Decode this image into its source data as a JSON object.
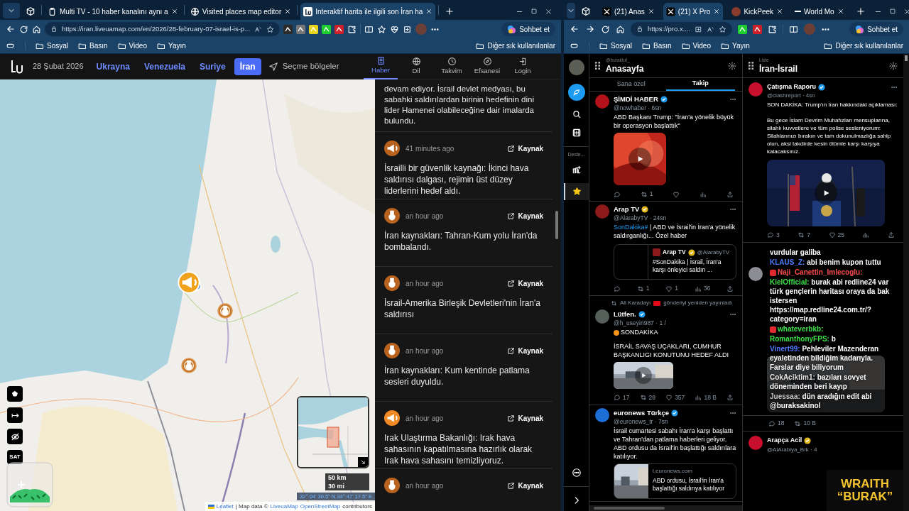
{
  "left_browser": {
    "tabs": [
      {
        "kind": "tv",
        "title": "Multi TV - 10 haber kanalını aynı a",
        "selected": false
      },
      {
        "kind": "globe",
        "title": "Visited places map editor",
        "selected": false
      },
      {
        "kind": "logo",
        "title": "Interaktif harita ile ilgili son İran ha",
        "selected": true
      }
    ],
    "address": "https://iran.liveuamap.com/en/2026/28-february-07-israel-is-p...",
    "copilot_button": "Sohbet et",
    "bookmarks": [
      "Sosyal",
      "Basın",
      "Video",
      "Yayın"
    ],
    "other_bookmarks": "Diğer sık kullanılanlar"
  },
  "liveuamap": {
    "date": "28 Şubat 2026",
    "regions": [
      {
        "label": "Ukrayna",
        "selected": false
      },
      {
        "label": "Venezuela",
        "selected": false
      },
      {
        "label": "Suriye",
        "selected": false
      },
      {
        "label": "İran",
        "selected": true
      }
    ],
    "select_regions": "Seçme bölgeler",
    "nav": [
      {
        "kind": "news",
        "label": "Haber",
        "selected": true
      },
      {
        "kind": "language",
        "label": "Dil",
        "selected": false
      },
      {
        "kind": "calendar",
        "label": "Takvim",
        "selected": false
      },
      {
        "kind": "legend",
        "label": "Efsanesi",
        "selected": false
      },
      {
        "kind": "login",
        "label": "Login",
        "selected": false
      }
    ],
    "map": {
      "markers": [
        {
          "kind": "megaphone"
        },
        {
          "kind": "bomb"
        },
        {
          "kind": "bomb"
        }
      ],
      "satellite_button": "SAT",
      "scale": [
        "50 km",
        "30 mi"
      ],
      "coordinates": "32° 04' 30.5\" N 34° 47' 17.5\" E",
      "attribution": {
        "leaflet": "Leaflet",
        "middle": "| Map data ©",
        "links": [
          "LiveuaMap",
          "OpenStreetMap"
        ],
        "tail": "contributors"
      }
    },
    "news_top_fragment": "devam ediyor. İsrail devlet medyası, bu sabahki saldırılardan birinin hedefinin dini lider Hamenei olabileceğine dair imalarda bulundu.",
    "news": [
      {
        "kind": "megaphone",
        "color": "#b8621d",
        "time": "41 minutes ago",
        "source": "Kaynak",
        "text": "İsrailli bir güvenlik kaynağı: İkinci hava saldırısı dalgası, rejimin üst düzey liderlerini hedef aldı."
      },
      {
        "kind": "bomb",
        "color": "#b8621d",
        "time": "an hour ago",
        "source": "Kaynak",
        "text": "İran kaynakları: Tahran-Kum yolu İran'da bombalandı."
      },
      {
        "kind": "bomb",
        "color": "#b8621d",
        "time": "an hour ago",
        "source": "Kaynak",
        "text": "İsrail-Amerika Birleşik Devletleri'nin İran'a saldırısı"
      },
      {
        "kind": "bomb",
        "color": "#b8621d",
        "time": "an hour ago",
        "source": "Kaynak",
        "text": "İran kaynakları: Kum kentinde patlama sesleri duyuldu."
      },
      {
        "kind": "megaphone",
        "color": "#f08a24",
        "time": "an hour ago",
        "source": "Kaynak",
        "text": "Irak Ulaştırma Bakanlığı: Irak hava sahasının kapatılmasına hazırlık olarak Irak hava sahasını temizliyoruz."
      },
      {
        "kind": "bomb",
        "color": "#b8621d",
        "time": "an hour ago",
        "source": "Kaynak"
      }
    ]
  },
  "right_browser": {
    "tabs": [
      {
        "kind": "x",
        "title": "(21) Anas",
        "selected": false
      },
      {
        "kind": "x",
        "title": "(21) X Pro",
        "selected": true
      },
      {
        "kind": "avatar",
        "title": "KickPeek",
        "selected": false
      },
      {
        "kind": "dash",
        "title": "World Mo",
        "selected": false
      }
    ],
    "address": "https://pro.x....",
    "copilot_button": "Sohbet et",
    "bookmarks": [
      "Sosyal",
      "Basın",
      "Video",
      "Yayın"
    ],
    "other_bookmarks": "Diğer sık kullanılanlar"
  },
  "xpro": {
    "sidebar_label": "Deste...",
    "home_column": {
      "account": "@buraktut_",
      "title": "Anasayfa",
      "tabs": [
        {
          "label": "Sana özel",
          "selected": false
        },
        {
          "label": "Takip",
          "selected": true
        }
      ],
      "tweets": [
        {
          "name": "ŞİMDİ HABER",
          "color": "#b3121b",
          "verified": true,
          "gold": false,
          "handle": "@nowhaber · 6sn",
          "text": "ABD Başkanı Trump: \"İran'a yönelik büyük bir operasyon başlattık\"",
          "media": {
            "kind": "video"
          },
          "actions": {
            "reposts": "1"
          }
        },
        {
          "name": "Arap TV",
          "color": "#8e1b1b",
          "verified": true,
          "gold": true,
          "handle": "@AlarabyTV · 24sn",
          "tag": "SonDakika#",
          "text": " | ABD ve İsrail'in İran'a yönelik saldırganlığı... Özel haber",
          "media": {
            "kind": "quote",
            "name": "Arap TV",
            "verified": true,
            "gold": true,
            "handle": "@AlarabyTV",
            "text": "#SonDakika | İsrail, İran'a karşı önleyici saldırı ..."
          },
          "actions": {
            "reposts": "1",
            "likes": "1",
            "views": "36"
          }
        },
        {
          "reposted_by": "Ali Karadayı",
          "repost_note": "gönderiyi yeniden yayınladı",
          "name": "Lütfen.",
          "color": "#55605a",
          "verified": true,
          "gold": false,
          "handle": "@h_useyin987 · 1 /",
          "label": "SONDAKİKA",
          "text": "İSRAİL SAVAŞ UÇAKLARI, CUMHUR BAŞKANLIGI KONUTUNU HEDEF ALDI",
          "media": {
            "kind": "video_small"
          },
          "actions": {
            "replies": "17",
            "reposts": "28",
            "likes": "357",
            "views": "18 B"
          }
        },
        {
          "name": "euronews Türkçe",
          "color": "#1d6fd8",
          "verified": true,
          "gold": false,
          "handle": "@euronews_tr · 7sn",
          "text": "İsrail cumartesi sabahı İran'a karşı başlattı ve Tahran'dan patlama haberleri geliyor. ABD ordusu da İsrail'in başlattığı saldırılara katılıyor.",
          "media": {
            "kind": "link_card",
            "domain": "l.euronews.com",
            "title": "ABD ordusu, İsrail'in İran'a başlattığı saldırıya katılıyor"
          }
        }
      ]
    },
    "list_column": {
      "account": "Liste",
      "title": "İran-İsrail",
      "tweet": {
        "name": "Çatışma Raporu",
        "color": "#c8102e",
        "verified": true,
        "gold": false,
        "handle": "@clashreport · 4sn",
        "text": "SON DAKİKA: Trump'ın İran hakkındaki açıklaması:\n\nBu gece İslam Devrim Muhafızları mensuplarına, silahlı kuvvetlere ve tüm polise sesleniyorum: Silahlarınızı bırakın ve tam dokunulmazlığa sahip olun, aksi takdirde kesin ölümle karşı karşıya kalacaksınız.",
        "actions": {
          "replies": "3",
          "reposts": "7",
          "likes": "25"
        }
      },
      "second_actions": {
        "replies": "18",
        "reposts": "10 B"
      },
      "last_tweet": {
        "name": "Arapça Acil",
        "color": "#c8102e",
        "verified": true,
        "gold": true,
        "handle": "@AlArabiya_Brk · 4"
      }
    }
  },
  "stream_chat": [
    {
      "text": "vurdular galiba",
      "badge": false
    },
    {
      "user": "KLAUS_Z:",
      "color": "#4f7cff",
      "text": "abi benim kupon tuttu",
      "badge": false
    },
    {
      "user": "Naji_Canettin_Imlecoglu:",
      "color": "#ff4d4d",
      "badge": true
    },
    {
      "user": "KielOfficial:",
      "color": "#3ee04a",
      "text": "burak abi redline24 var türk gençlerin haritası oraya da bak istersen https://map.redline24.com.tr/?category=iran",
      "badge": false
    },
    {
      "user": "whateverbkb:",
      "color": "#3ee04a",
      "badge": true
    },
    {
      "user": "RomanthonyFPS:",
      "color": "#3ee04a",
      "text": "b",
      "badge": false
    },
    {
      "user": "Vinert99:",
      "color": "#4f7cff",
      "text": "Pehleviler Mazenderan eyaletinden bildiğim kadarıyla. Farslar diye biliyorum",
      "badge": false
    },
    {
      "user": "CokAciktim1:",
      "color": "#e8e8e8",
      "text": "bazıları sovyet döneminden beri kayıp",
      "badge": false
    },
    {
      "user": "Juessaa:",
      "color": "#c9c9c9",
      "text": "dün aradığın edit abi @buraksakinol",
      "badge": false
    }
  ],
  "stream_logo": [
    "WRAITH",
    "“BURAK”"
  ]
}
